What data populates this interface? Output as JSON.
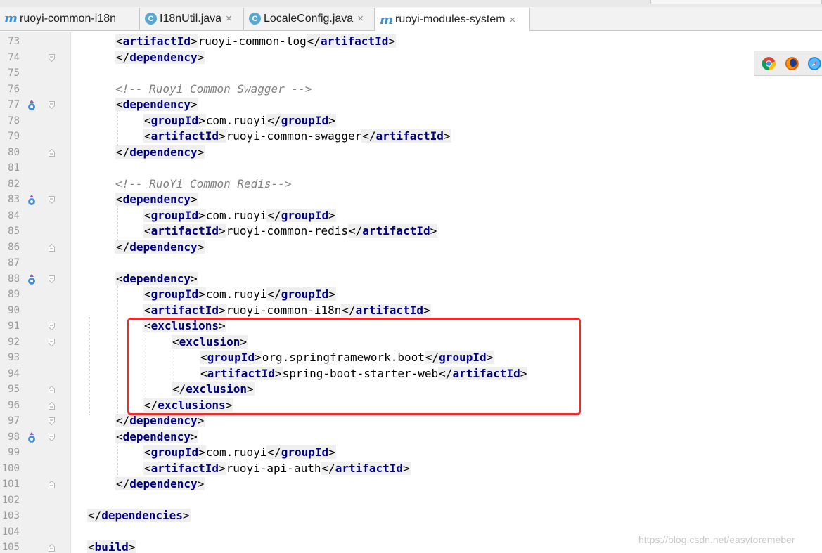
{
  "tabs": [
    {
      "label": "ruoyi-common-i18n",
      "icon": "maven-icon",
      "active": false
    },
    {
      "label": "I18nUtil.java",
      "icon": "java-class-icon",
      "active": false,
      "close": "×"
    },
    {
      "label": "LocaleConfig.java",
      "icon": "java-class-icon",
      "active": false,
      "close": "×"
    },
    {
      "label": "ruoyi-modules-system",
      "icon": "maven-icon",
      "active": true,
      "close": "×"
    }
  ],
  "icon_glyphs": {
    "maven": "m",
    "class": "C"
  },
  "lines": [
    {
      "n": "73",
      "code": "<artifactId>ruoyi-common-log</artifactId>"
    },
    {
      "n": "74",
      "code": "</dependency>"
    },
    {
      "n": "75",
      "code": ""
    },
    {
      "n": "76",
      "code": "<!-- Ruoyi Common Swagger -->"
    },
    {
      "n": "77",
      "code": "<dependency>"
    },
    {
      "n": "78",
      "code": "<groupId>com.ruoyi</groupId>"
    },
    {
      "n": "79",
      "code": "<artifactId>ruoyi-common-swagger</artifactId>"
    },
    {
      "n": "80",
      "code": "</dependency>"
    },
    {
      "n": "81",
      "code": ""
    },
    {
      "n": "82",
      "code": "<!-- RuoYi Common Redis-->"
    },
    {
      "n": "83",
      "code": "<dependency>"
    },
    {
      "n": "84",
      "code": "<groupId>com.ruoyi</groupId>"
    },
    {
      "n": "85",
      "code": "<artifactId>ruoyi-common-redis</artifactId>"
    },
    {
      "n": "86",
      "code": "</dependency>"
    },
    {
      "n": "87",
      "code": ""
    },
    {
      "n": "88",
      "code": "<dependency>"
    },
    {
      "n": "89",
      "code": "<groupId>com.ruoyi</groupId>"
    },
    {
      "n": "90",
      "code": "<artifactId>ruoyi-common-i18n</artifactId>"
    },
    {
      "n": "91",
      "code": "<exclusions>"
    },
    {
      "n": "92",
      "code": "<exclusion>"
    },
    {
      "n": "93",
      "code": "<groupId>org.springframework.boot</groupId>"
    },
    {
      "n": "94",
      "code": "<artifactId>spring-boot-starter-web</artifactId>"
    },
    {
      "n": "95",
      "code": "</exclusion>"
    },
    {
      "n": "96",
      "code": "</exclusions>"
    },
    {
      "n": "97",
      "code": "</dependency>"
    },
    {
      "n": "98",
      "code": "<dependency>"
    },
    {
      "n": "99",
      "code": "<groupId>com.ruoyi</groupId>"
    },
    {
      "n": "100",
      "code": "<artifactId>ruoyi-api-auth</artifactId>"
    },
    {
      "n": "101",
      "code": "</dependency>"
    },
    {
      "n": "102",
      "code": ""
    },
    {
      "n": "103",
      "code": "</dependencies>"
    },
    {
      "n": "104",
      "code": ""
    },
    {
      "n": "105",
      "code": "<build>"
    }
  ],
  "browsers": [
    "chrome-icon",
    "firefox-icon",
    "safari-icon"
  ],
  "watermark": "https://blog.csdn.net/easytoremeber",
  "colors": {
    "tag": "#000080",
    "comment": "#808080",
    "highlight": "#f02b2b",
    "line_number": "#999999"
  }
}
